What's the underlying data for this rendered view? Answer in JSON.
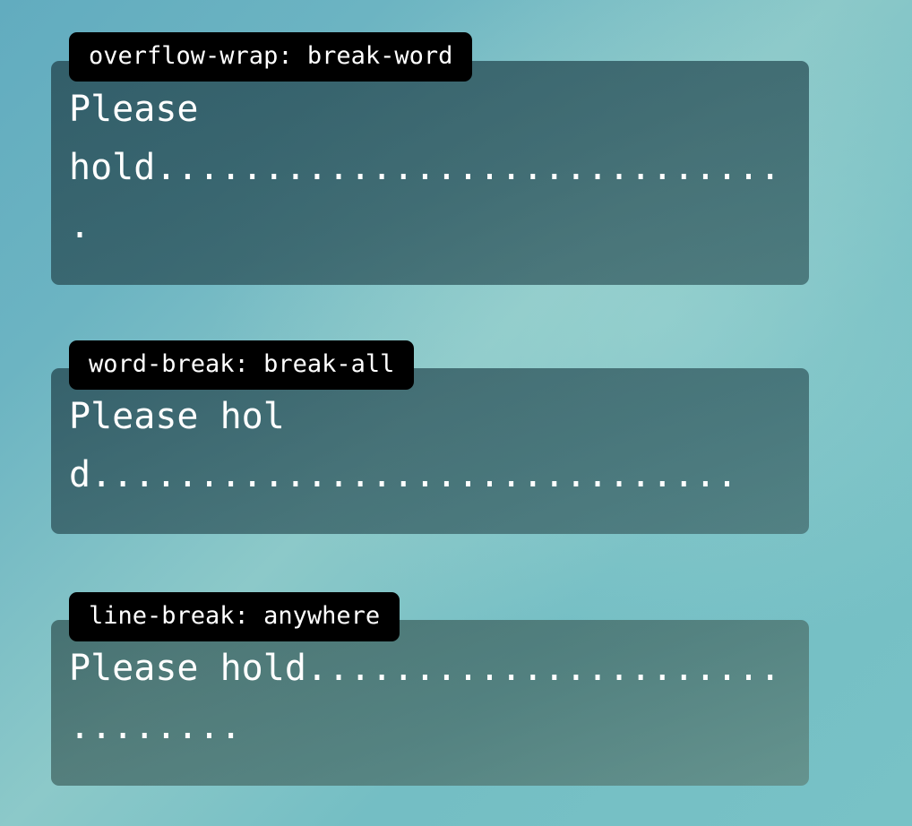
{
  "page": {
    "title": "CSS word breaking comparison",
    "background_gradient_from": "#62acbf",
    "background_gradient_to": "#78c2c6",
    "badge_background": "#000000",
    "badge_text_color": "#ffffff",
    "card_text_color": "#ffffff"
  },
  "demos": [
    {
      "id": "overflow-wrap-break-word",
      "badge_label": "overflow-wrap: break-word",
      "content": "Please hold..............................",
      "rendered_lines": [
        "Please",
        "hold........................",
        "......"
      ],
      "card_fill": "rgba(45, 84, 92, 0.78)"
    },
    {
      "id": "word-break-break-all",
      "badge_label": "word-break: break-all",
      "content": "Please hold..............................",
      "rendered_lines": [
        "Please hol",
        "d............................."
      ],
      "card_fill": "rgba(52, 92, 98, 0.76)"
    },
    {
      "id": "line-break-anywhere",
      "badge_label": "line-break: anywhere",
      "content": "Please hold..............................",
      "rendered_lines": [
        "Please hold..................",
        "............"
      ],
      "card_fill": "rgba(70, 106, 102, 0.72)"
    }
  ]
}
